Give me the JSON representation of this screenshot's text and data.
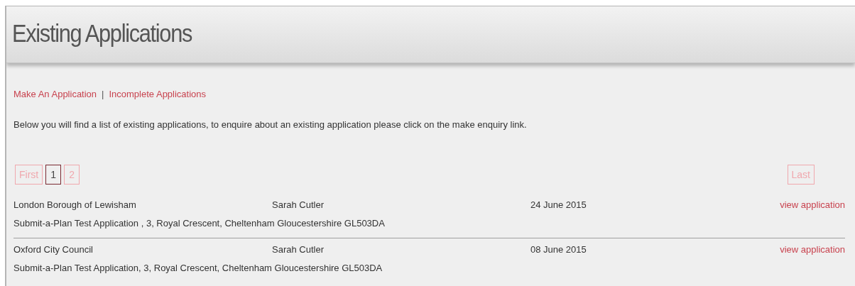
{
  "header": {
    "title": "Existing Applications"
  },
  "links": [
    "Make An Application",
    "Incomplete Applications"
  ],
  "separator": "|",
  "intro": "Below you will find a list of existing applications, to enquire about an existing application please click on the make enquiry link.",
  "pagination": {
    "first": "First",
    "pages": [
      {
        "label": "1",
        "selected": true
      },
      {
        "label": "2",
        "selected": false
      }
    ],
    "last": "Last"
  },
  "applications": [
    {
      "council": "London Borough of Lewisham",
      "applicant": "Sarah Cutler",
      "date": "24 June 2015",
      "action": "view application",
      "address": "Submit-a-Plan Test Application , 3, Royal Crescent, Cheltenham Gloucestershire GL503DA"
    },
    {
      "council": "Oxford City Council",
      "applicant": "Sarah Cutler",
      "date": "08 June 2015",
      "action": "view application",
      "address": "Submit-a-Plan Test Application, 3, Royal Crescent, Cheltenham Gloucestershire GL503DA"
    }
  ]
}
